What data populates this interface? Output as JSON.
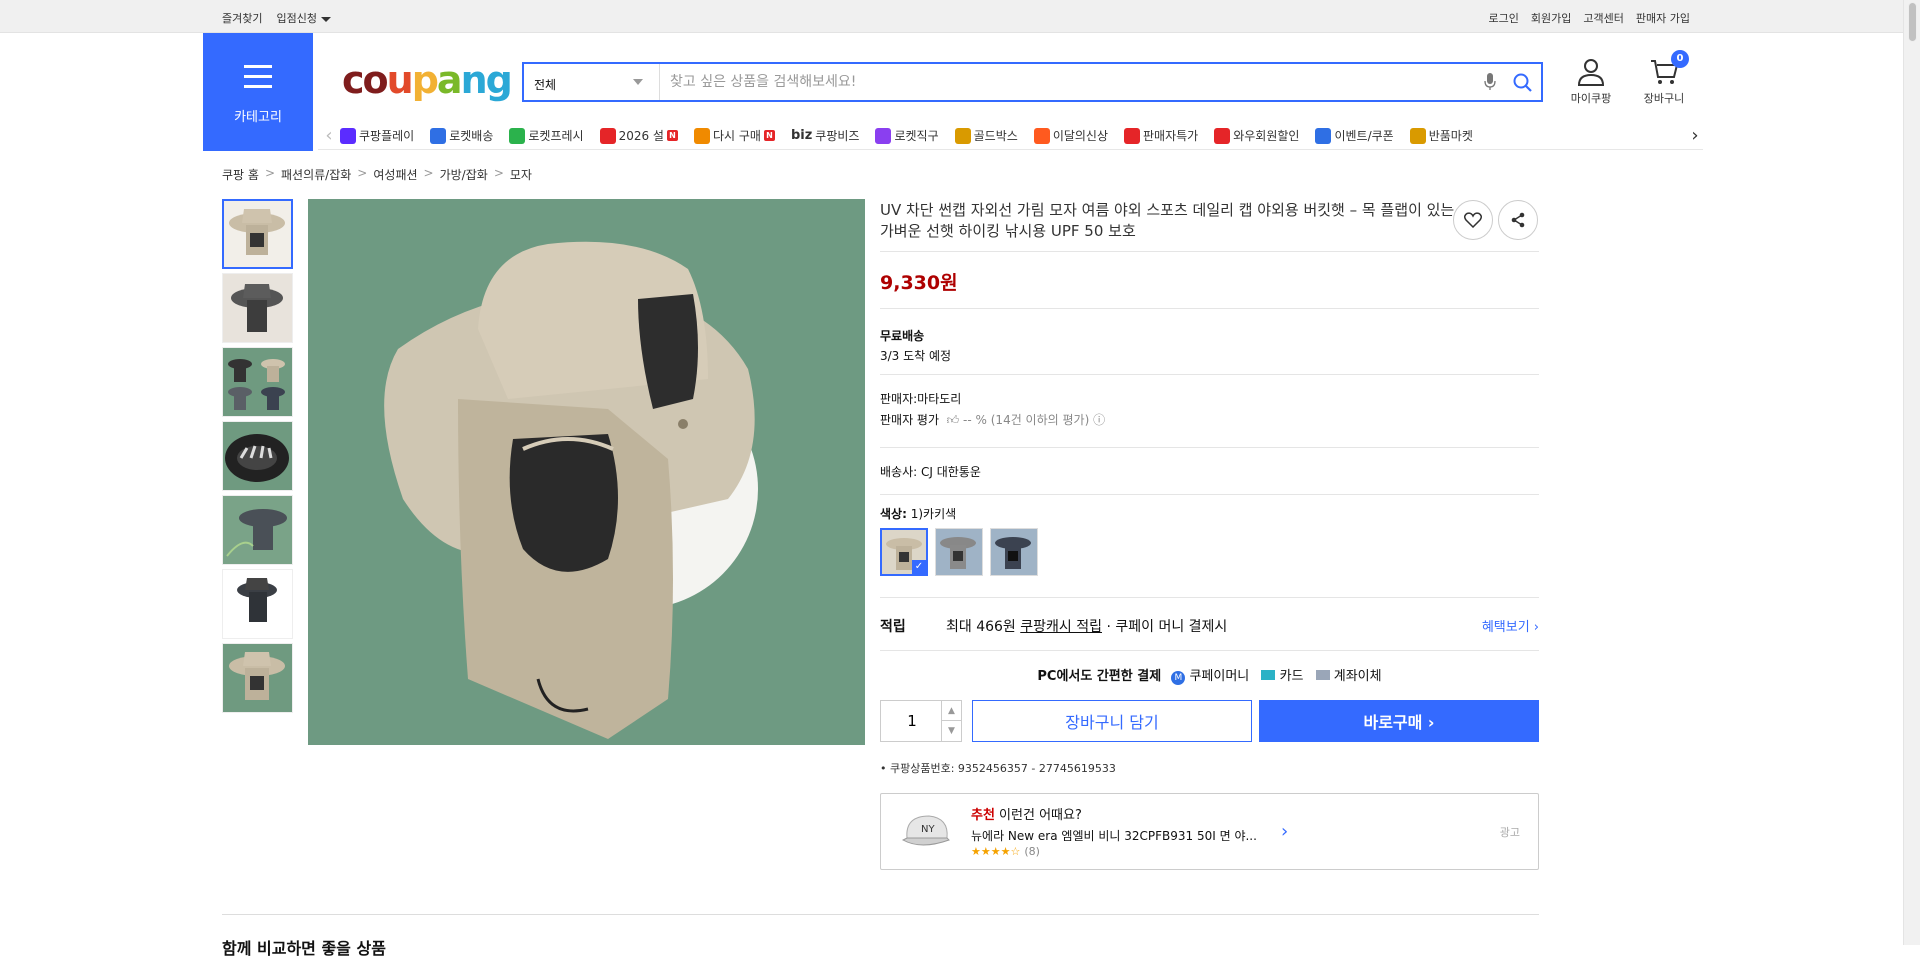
{
  "topbar": {
    "left": [
      "즐겨찾기",
      "입점신청"
    ],
    "right": [
      "로그인",
      "회원가입",
      "고객센터",
      "판매자 가입"
    ]
  },
  "header": {
    "category_label": "카테고리",
    "logo": "coupang",
    "search_category": "전체",
    "search_placeholder": "찾고 싶은 상품을 검색해보세요!",
    "mycoupang": "마이쿠팡",
    "cart": "장바구니",
    "cart_count": "0"
  },
  "nav": {
    "items": [
      {
        "label": "쿠팡플레이",
        "icon": "play-icon",
        "color": "#5b2cff"
      },
      {
        "label": "로켓배송",
        "icon": "rocket-icon",
        "color": "#2f6fe4"
      },
      {
        "label": "로켓프레시",
        "icon": "rocket-fresh-icon",
        "color": "#2bb24c"
      },
      {
        "label": "2026 설",
        "icon": "gift-icon",
        "color": "#e52528",
        "badge": "N"
      },
      {
        "label": "다시 구매",
        "icon": "home-icon",
        "color": "#f08a00",
        "badge": "N"
      },
      {
        "label": "쿠팡비즈",
        "icon": "biz-icon",
        "color": "#333333",
        "prefix": "biz"
      },
      {
        "label": "로켓직구",
        "icon": "global-icon",
        "color": "#8a3ff0"
      },
      {
        "label": "골드박스",
        "icon": "goldbox-icon",
        "color": "#d99a00"
      },
      {
        "label": "이달의신상",
        "icon": "new-icon",
        "color": "#ff5a1f"
      },
      {
        "label": "판매자특가",
        "icon": "percent-icon",
        "color": "#e52528"
      },
      {
        "label": "와우회원할인",
        "icon": "wow-icon",
        "color": "#e52528"
      },
      {
        "label": "이벤트/쿠폰",
        "icon": "coupon-icon",
        "color": "#2f6fe4"
      },
      {
        "label": "반품마켓",
        "icon": "market-icon",
        "color": "#d99a00"
      }
    ]
  },
  "breadcrumb": [
    "쿠팡 홈",
    "패션의류/잡화",
    "여성패션",
    "가방/잡화",
    "모자"
  ],
  "product": {
    "title": "UV 차단 썬캡 자외선 가림 모자 여름 야외 스포츠 데일리 캡 야외용 버킷햇 – 목 플랩이 있는 가벼운 선햇 하이킹 낚시용 UPF 50 보호",
    "price": "9,330원",
    "delivery_label": "무료배송",
    "delivery_date": "3/3 도착 예정",
    "seller": "판매자:마타도리",
    "seller_rating_label": "판매자 평가",
    "seller_rating_value": "-- %",
    "seller_rating_note": "(14건 이하의 평가)",
    "shipping_company": "배송사:  CJ 대한통운",
    "color_label": "색상:",
    "color_value": "1)카키색",
    "reward_key": "적립",
    "reward_text_1": "최대 466원 ",
    "reward_text_2": "쿠팡캐시 적립",
    "reward_text_3": " · 쿠페이 머니 결제시",
    "reward_more": "혜택보기",
    "pay_title": "PC에서도 간편한 결제",
    "pay_options": [
      "쿠페이머니",
      "카드",
      "계좌이체"
    ],
    "quantity": "1",
    "add_to_cart": "장바구니 담기",
    "buy_now": "바로구매",
    "product_id": "쿠팡상품번호: 9352456357 - 27745619533"
  },
  "recommend": {
    "title_accent": "추천",
    "title_rest": " 이런건 어때요?",
    "name": "뉴에라 New era 엠엘비 비니 32CPFB931 50I 면 야...",
    "stars": "★★★★☆",
    "count": "(8)",
    "ad": "광고"
  },
  "section_heading": "함께 비교하면 좋을 상품"
}
